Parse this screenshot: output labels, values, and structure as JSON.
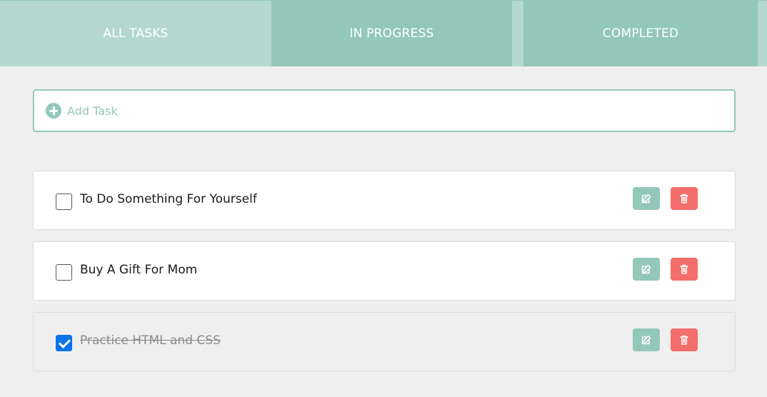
{
  "tabs": [
    {
      "label": "ALL TASKS",
      "active": true
    },
    {
      "label": "IN PROGRESS",
      "active": false
    },
    {
      "label": "COMPLETED",
      "active": false
    }
  ],
  "add_task": {
    "placeholder": "Add Task",
    "value": "",
    "icon": "plus-circle-icon"
  },
  "tasks": [
    {
      "label": "To Do Something For Yourself",
      "completed": false
    },
    {
      "label": "Buy A Gift For Mom",
      "completed": false
    },
    {
      "label": "Practice HTML and CSS",
      "completed": true
    }
  ],
  "task_actions": {
    "edit_icon": "edit-icon",
    "delete_icon": "trash-icon"
  },
  "colors": {
    "accent": "#93c7ba",
    "active_tab": "#b4d8d0",
    "delete": "#f36e6b",
    "checkbox_checked": "#0b73e8",
    "background": "#efefef"
  }
}
